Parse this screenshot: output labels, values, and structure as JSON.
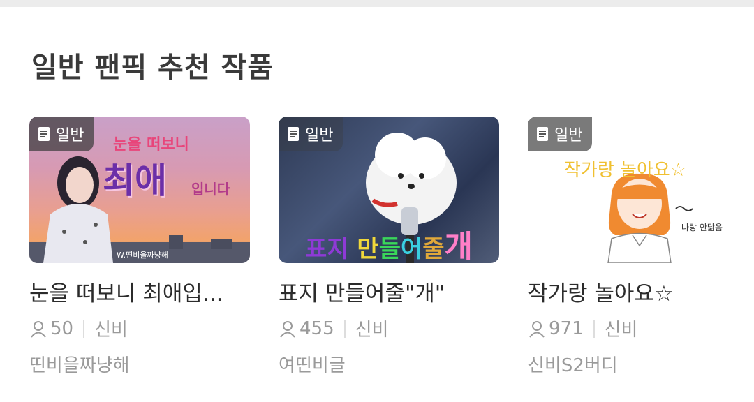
{
  "section_title": "일반 팬픽 추천 작품",
  "cards": [
    {
      "badge": "일반",
      "thumb_text": {
        "top": "눈을 떠보니",
        "main": "최애",
        "side": "입니다",
        "credit": "W.띤비을짜냥해"
      },
      "title": "눈을 떠보니 최애입...",
      "count": "50",
      "category": "신비",
      "author": "띤비을짜냥해"
    },
    {
      "badge": "일반",
      "thumb_text": {
        "a": "표지",
        "b": "만",
        "c": "들",
        "d": "어",
        "e": "줄",
        "f": "개"
      },
      "title": "표지 만들어줄\"개\"",
      "count": "455",
      "category": "신비",
      "author": "여띤비글"
    },
    {
      "badge": "일반",
      "thumb_text": {
        "main": "작가랑 놀아요☆",
        "side": "나랑 안닮음"
      },
      "title": "작가랑 놀아요☆",
      "count": "971",
      "category": "신비",
      "author": "신비S2버디"
    }
  ],
  "colors": {
    "accent_purple": "#7a3fc0",
    "text_gray": "#9a9a9a"
  }
}
